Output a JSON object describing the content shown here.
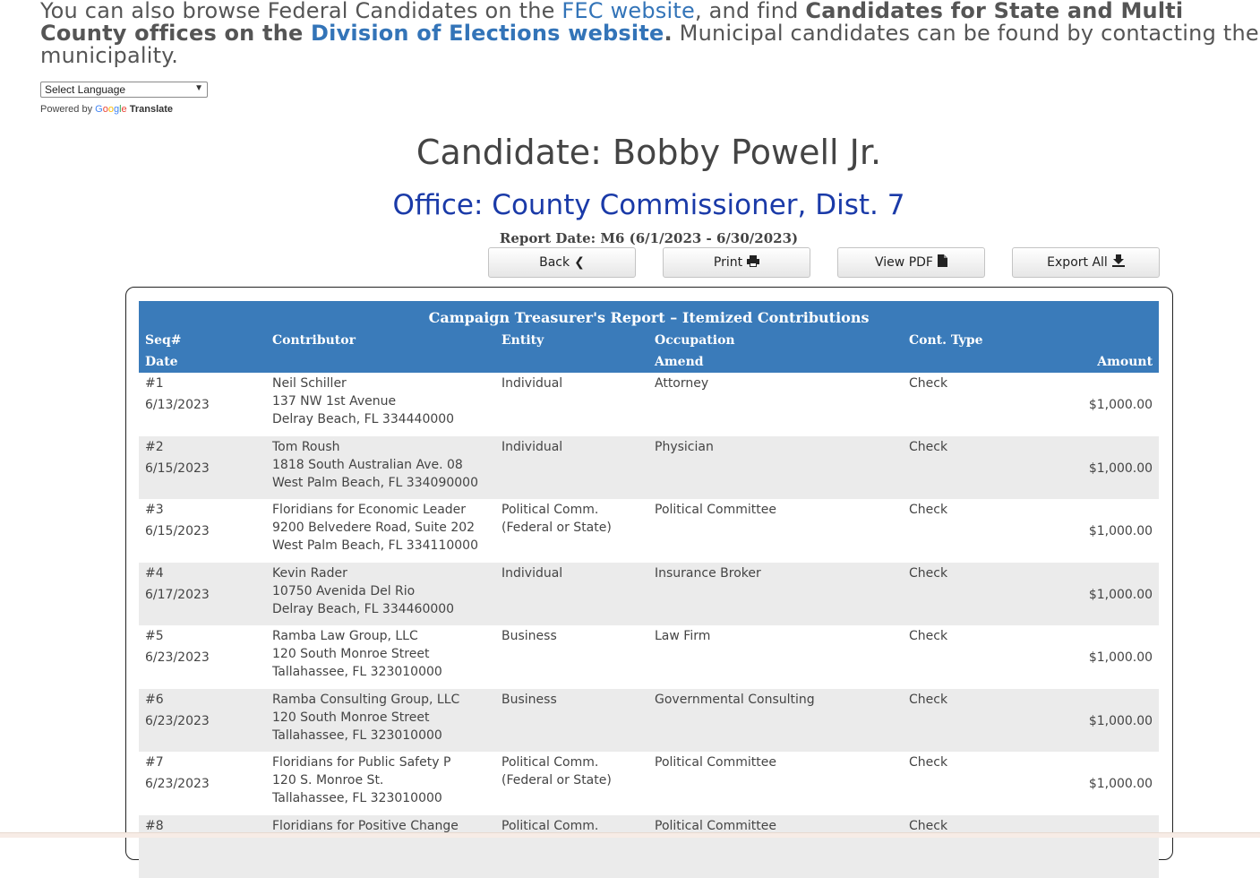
{
  "intro": {
    "text1": "You can also browse Federal Candidates on the ",
    "fec_link": "FEC website",
    "text2": ", and find ",
    "bold1": "Candidates for State and Multi County offices on the ",
    "doe_link": "Division of Elections website",
    "bold2": ".",
    "text3": " Municipal candidates can be found by contacting the municipality."
  },
  "translate": {
    "select_value": "Select Language",
    "powered_by": "Powered by",
    "google": [
      "G",
      "o",
      "o",
      "g",
      "l",
      "e"
    ],
    "translate": "Translate"
  },
  "candidate": "Candidate: Bobby Powell Jr.",
  "office": "Office: County Commissioner, Dist. 7",
  "report_date": "Report Date: M6 (6/1/2023 - 6/30/2023)",
  "buttons": {
    "back": "Back",
    "print": "Print",
    "view_pdf": "View PDF",
    "export_all": "Export All"
  },
  "table": {
    "title": "Campaign Treasurer's Report – Itemized Contributions",
    "headers": {
      "seq": "Seq#",
      "date": "Date",
      "contributor": "Contributor",
      "entity": "Entity",
      "occupation": "Occupation",
      "amend": "Amend",
      "cont_type": "Cont. Type",
      "amount": "Amount"
    },
    "rows": [
      {
        "seq": "#1",
        "date": "6/13/2023",
        "name": "Neil Schiller",
        "addr1": "137 NW 1st Avenue",
        "addr2": "Delray Beach, FL 334440000",
        "entity1": "Individual",
        "entity2": "",
        "occupation": "Attorney",
        "type": "Check",
        "amount": "$1,000.00"
      },
      {
        "seq": "#2",
        "date": "6/15/2023",
        "name": "Tom Roush",
        "addr1": "1818 South Australian Ave. 08",
        "addr2": "West Palm Beach, FL 334090000",
        "entity1": "Individual",
        "entity2": "",
        "occupation": "Physician",
        "type": "Check",
        "amount": "$1,000.00"
      },
      {
        "seq": "#3",
        "date": "6/15/2023",
        "name": "Floridians for Economic Leader",
        "addr1": "9200 Belvedere Road, Suite 202",
        "addr2": "West Palm Beach, FL 334110000",
        "entity1": "Political Comm.",
        "entity2": "(Federal or State)",
        "occupation": "Political Committee",
        "type": "Check",
        "amount": "$1,000.00"
      },
      {
        "seq": "#4",
        "date": "6/17/2023",
        "name": "Kevin Rader",
        "addr1": "10750 Avenida Del Rio",
        "addr2": "Delray Beach, FL 334460000",
        "entity1": "Individual",
        "entity2": "",
        "occupation": "Insurance Broker",
        "type": "Check",
        "amount": "$1,000.00"
      },
      {
        "seq": "#5",
        "date": "6/23/2023",
        "name": "Ramba Law Group, LLC",
        "addr1": "120 South Monroe Street",
        "addr2": "Tallahassee, FL 323010000",
        "entity1": "Business",
        "entity2": "",
        "occupation": "Law Firm",
        "type": "Check",
        "amount": "$1,000.00"
      },
      {
        "seq": "#6",
        "date": "6/23/2023",
        "name": "Ramba Consulting Group, LLC",
        "addr1": "120 South Monroe Street",
        "addr2": "Tallahassee, FL 323010000",
        "entity1": "Business",
        "entity2": "",
        "occupation": "Governmental Consulting",
        "type": "Check",
        "amount": "$1,000.00"
      },
      {
        "seq": "#7",
        "date": "6/23/2023",
        "name": "Floridians for Public Safety P",
        "addr1": "120 S. Monroe St.",
        "addr2": "Tallahassee, FL 323010000",
        "entity1": "Political Comm.",
        "entity2": "(Federal or State)",
        "occupation": "Political Committee",
        "type": "Check",
        "amount": "$1,000.00"
      },
      {
        "seq": "#8",
        "date": "",
        "name": "Floridians for Positive Change",
        "addr1": "",
        "addr2": "",
        "entity1": "Political Comm.",
        "entity2": "",
        "occupation": "Political Committee",
        "type": "Check",
        "amount": ""
      }
    ]
  }
}
